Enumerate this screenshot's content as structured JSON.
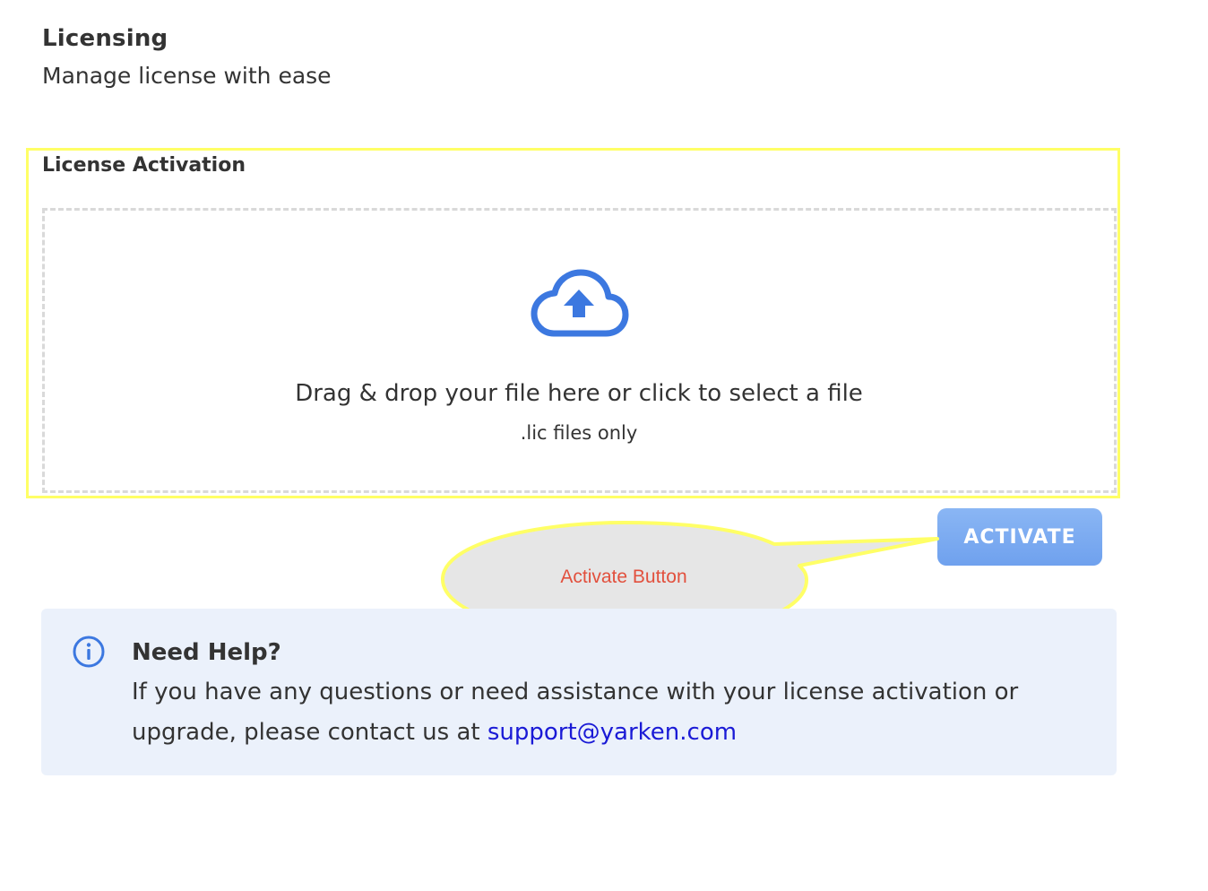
{
  "header": {
    "title": "Licensing",
    "subtitle": "Manage license with ease"
  },
  "activation": {
    "title": "License Activation",
    "dropzone": {
      "icon": "cloud-upload-icon",
      "text": "Drag & drop your file here or click to select a file",
      "hint": ".lic files only"
    },
    "button_label": "ACTIVATE"
  },
  "annotation": {
    "callout_text": "Activate Button",
    "highlight_color": "#ffff66",
    "text_color": "#e2503d"
  },
  "help": {
    "icon": "info-icon",
    "title": "Need Help?",
    "body_line1": "If you have any questions or need assistance with your license activation or",
    "body_line2": "upgrade, please contact us at ",
    "email": "support@yarken.com"
  },
  "colors": {
    "accent": "#3c78e0",
    "button": "#7aa9f0",
    "help_bg": "#ebf1fb",
    "link": "#1a1ad6"
  }
}
